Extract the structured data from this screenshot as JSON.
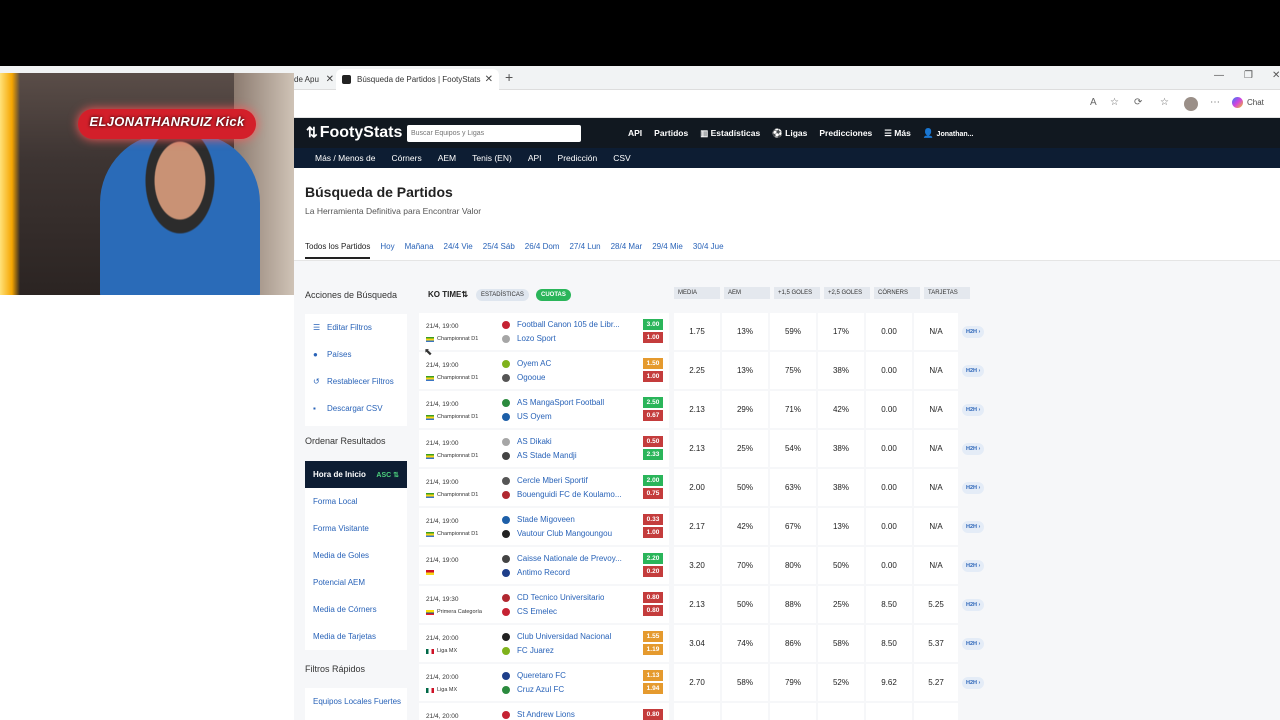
{
  "browser": {
    "old_tab_title": "de Apu",
    "active_tab_title": "Búsqueda de Partidos | FootyStats",
    "chat_label": "Chat"
  },
  "webcam": {
    "overlay_name": "ELJONATHANRUIZ Kick"
  },
  "site": {
    "logo": "FootyStats",
    "search_placeholder": "Buscar Equipos y Ligas",
    "topnav": [
      "API",
      "Partidos",
      "Estadísticas",
      "Ligas",
      "Predicciones",
      "Más",
      "Jonathan..."
    ],
    "subnav": [
      "Más / Menos de",
      "Córners",
      "AEM",
      "Tenis (EN)",
      "API",
      "Predicción",
      "CSV"
    ]
  },
  "page": {
    "title": "Búsqueda de Partidos",
    "subtitle": "La Herramienta Definitiva para Encontrar Valor",
    "date_tabs": [
      "Todos los Partidos",
      "Hoy",
      "Mañana",
      "24/4 Vie",
      "25/4 Sáb",
      "26/4 Dom",
      "27/4 Lun",
      "28/4 Mar",
      "29/4 Mie",
      "30/4 Jue"
    ]
  },
  "sidebar": {
    "actions_title": "Acciones de Búsqueda",
    "actions": [
      "Editar Filtros",
      "Países",
      "Restablecer Filtros",
      "Descargar CSV"
    ],
    "sort_title": "Ordenar Resultados",
    "sort_active": "Hora de Inicio",
    "sort_asc": "ASC",
    "sort_items": [
      "Forma Local",
      "Forma Visitante",
      "Media de Goles",
      "Potencial AEM",
      "Media de Córners",
      "Media de Tarjetas"
    ],
    "quick_title": "Filtros Rápidos",
    "quick_items": [
      "Equipos Locales Fuertes"
    ]
  },
  "table": {
    "ko_time": "KO TIME",
    "stats_pill": "ESTADÍSTICAS",
    "odds_pill": "CUOTAS",
    "columns": [
      "MEDIA",
      "AEM",
      "+1,5 GOLES",
      "+2,5 GOLES",
      "CÓRNERS",
      "TARJETAS"
    ],
    "h2h_label": "H2H",
    "rows": [
      {
        "time": "21/4, 19:00",
        "league": "Championnat D1",
        "home": "Football Canon 105 de Libr...",
        "away": "Lozo Sport",
        "odd_h": "3.00",
        "odd_a": "1.00",
        "stats": [
          "1.75",
          "13%",
          "59%",
          "17%",
          "0.00",
          "N/A"
        ]
      },
      {
        "time": "21/4, 19:00",
        "league": "Championnat D1",
        "home": "Oyem AC",
        "away": "Ogooue",
        "odd_h": "1.50",
        "odd_a": "1.00",
        "stats": [
          "2.25",
          "13%",
          "75%",
          "38%",
          "0.00",
          "N/A"
        ]
      },
      {
        "time": "21/4, 19:00",
        "league": "Championnat D1",
        "home": "AS MangaSport Football",
        "away": "US Oyem",
        "odd_h": "2.50",
        "odd_a": "0.67",
        "stats": [
          "2.13",
          "29%",
          "71%",
          "42%",
          "0.00",
          "N/A"
        ]
      },
      {
        "time": "21/4, 19:00",
        "league": "Championnat D1",
        "home": "AS Dikaki",
        "away": "AS Stade Mandji",
        "odd_h": "0.50",
        "odd_a": "2.33",
        "stats": [
          "2.13",
          "25%",
          "54%",
          "38%",
          "0.00",
          "N/A"
        ]
      },
      {
        "time": "21/4, 19:00",
        "league": "Championnat D1",
        "home": "Cercle Mberi Sportif",
        "away": "Bouenguidi FC de Koulamo...",
        "odd_h": "2.00",
        "odd_a": "0.75",
        "stats": [
          "2.00",
          "50%",
          "63%",
          "38%",
          "0.00",
          "N/A"
        ]
      },
      {
        "time": "21/4, 19:00",
        "league": "Championnat D1",
        "home": "Stade Migoveen",
        "away": "Vautour Club Mangoungou",
        "odd_h": "0.33",
        "odd_a": "1.00",
        "stats": [
          "2.17",
          "42%",
          "67%",
          "13%",
          "0.00",
          "N/A"
        ]
      },
      {
        "time": "21/4, 19:00",
        "league": "",
        "home": "Caisse Nationale de Prevoy...",
        "away": "Antimo Record",
        "odd_h": "2.20",
        "odd_a": "0.20",
        "stats": [
          "3.20",
          "70%",
          "80%",
          "50%",
          "0.00",
          "N/A"
        ]
      },
      {
        "time": "21/4, 19:30",
        "league": "Primera Categoría",
        "home": "CD Tecnico Universitario",
        "away": "CS Emelec",
        "odd_h": "0.80",
        "odd_a": "0.80",
        "stats": [
          "2.13",
          "50%",
          "88%",
          "25%",
          "8.50",
          "5.25"
        ]
      },
      {
        "time": "21/4, 20:00",
        "league": "Liga MX",
        "home": "Club Universidad Nacional",
        "away": "FC Juarez",
        "odd_h": "1.55",
        "odd_a": "1.19",
        "stats": [
          "3.04",
          "74%",
          "86%",
          "58%",
          "8.50",
          "5.37"
        ]
      },
      {
        "time": "21/4, 20:00",
        "league": "Liga MX",
        "home": "Queretaro FC",
        "away": "Cruz Azul FC",
        "odd_h": "1.13",
        "odd_a": "1.94",
        "stats": [
          "2.70",
          "58%",
          "79%",
          "52%",
          "9.62",
          "5.27"
        ]
      },
      {
        "time": "21/4, 20:00",
        "league": "",
        "home": "St Andrew Lions",
        "away": "",
        "odd_h": "0.80",
        "odd_a": "",
        "stats": [
          "",
          "",
          "",
          "",
          "",
          ""
        ]
      }
    ]
  },
  "colors": {
    "header_dark": "#111820",
    "subnav": "#0d1d33",
    "link": "#2963b8",
    "odds_green": "#2ab55a",
    "odds_orange": "#e59a2e",
    "odds_red": "#c43c3c"
  }
}
